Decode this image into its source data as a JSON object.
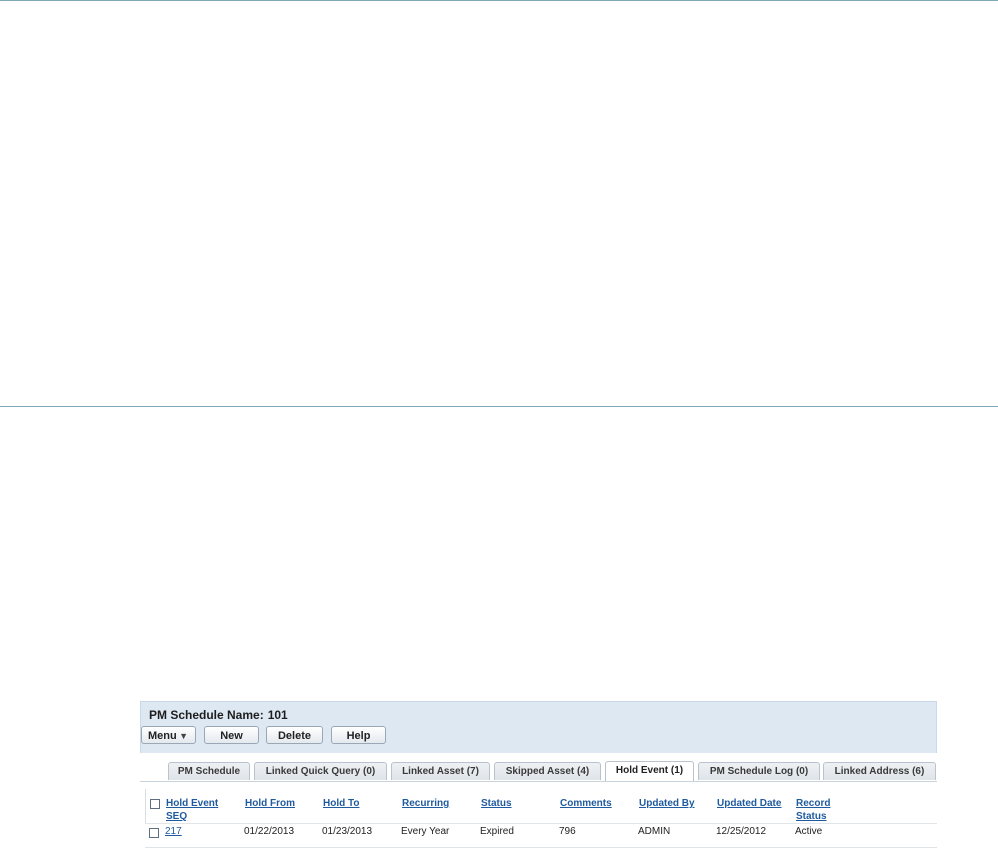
{
  "record": {
    "label": "PM Schedule Name:",
    "value": "101"
  },
  "toolbar": {
    "menu_label": "Menu",
    "new_label": "New",
    "delete_label": "Delete",
    "help_label": "Help"
  },
  "tabs": [
    {
      "label": "PM Schedule",
      "active": false
    },
    {
      "label": "Linked Quick Query (0)",
      "active": false
    },
    {
      "label": "Linked Asset (7)",
      "active": false
    },
    {
      "label": "Skipped Asset (4)",
      "active": false
    },
    {
      "label": "Hold Event (1)",
      "active": true
    },
    {
      "label": "PM Schedule Log (0)",
      "active": false
    },
    {
      "label": "Linked Address (6)",
      "active": false
    }
  ],
  "table": {
    "columns": [
      {
        "line1": "Hold Event",
        "line2": "SEQ"
      },
      {
        "line1": "Hold From",
        "line2": ""
      },
      {
        "line1": "Hold To",
        "line2": ""
      },
      {
        "line1": "Recurring",
        "line2": ""
      },
      {
        "line1": "Status",
        "line2": ""
      },
      {
        "line1": "Comments",
        "line2": ""
      },
      {
        "line1": "Updated By",
        "line2": ""
      },
      {
        "line1": "Updated Date",
        "line2": ""
      },
      {
        "line1": "Record",
        "line2": "Status"
      }
    ],
    "rows": [
      {
        "seq": "217",
        "hold_from": "01/22/2013",
        "hold_to": "01/23/2013",
        "recurring": "Every Year",
        "status": "Expired",
        "comments": "796",
        "updated_by": "ADMIN",
        "updated_date": "12/25/2012",
        "record_status": "Active"
      }
    ]
  }
}
